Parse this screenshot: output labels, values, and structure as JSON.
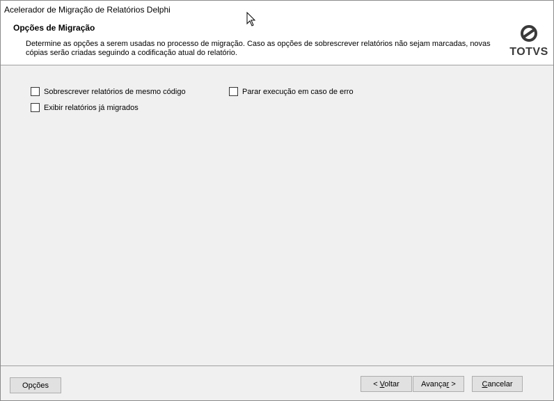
{
  "window": {
    "title": "Acelerador de Migração de Relatórios Delphi"
  },
  "header": {
    "title": "Opções de Migração",
    "description": "Determine as opções a serem usadas no processo de migração. Caso as opções de sobrescrever relatórios não sejam marcadas, novas cópias serão criadas seguindo a codificação atual do relatório.",
    "logo_text": "TOTVS"
  },
  "options": {
    "overwrite": {
      "label": "Sobrescrever relatórios de mesmo código",
      "checked": false
    },
    "show_migrated": {
      "label": "Exibir relatórios já migrados",
      "checked": false
    },
    "stop_on_error": {
      "label": "Parar execução em caso de erro",
      "checked": false
    }
  },
  "footer": {
    "options_label": "Opções",
    "back_prefix": "< ",
    "back_hotkey": "V",
    "back_rest": "oltar",
    "next_prefix": "Avança",
    "next_hotkey": "r",
    "next_suffix": " >",
    "cancel_hotkey": "C",
    "cancel_rest": "ancelar"
  }
}
